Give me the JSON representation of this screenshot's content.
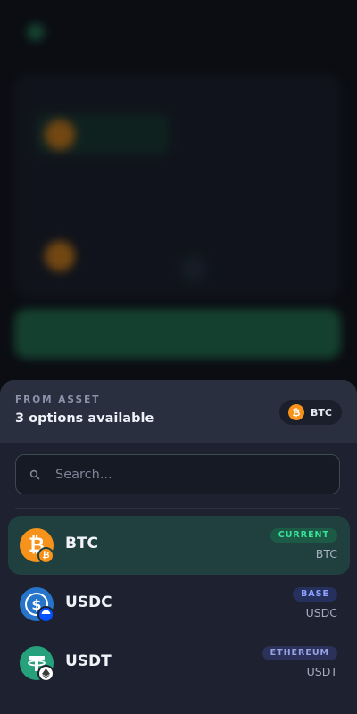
{
  "sheet": {
    "label": "FROM ASSET",
    "options_text": "3 options available",
    "selected_pill": {
      "symbol": "BTC",
      "icon": "bitcoin-icon"
    },
    "search": {
      "placeholder": "Search..."
    },
    "assets": [
      {
        "symbol": "BTC",
        "network_tag": "CURRENT",
        "subtitle": "BTC",
        "coin_icon": "bitcoin-icon",
        "network_icon": "bitcoin-icon",
        "selected": true
      },
      {
        "symbol": "USDC",
        "network_tag": "BASE",
        "subtitle": "USDC",
        "coin_icon": "usdc-icon",
        "network_icon": "base-icon",
        "selected": false
      },
      {
        "symbol": "USDT",
        "network_tag": "ETHEREUM",
        "subtitle": "USDT",
        "coin_icon": "tether-icon",
        "network_icon": "ethereum-icon",
        "selected": false
      }
    ]
  },
  "colors": {
    "bitcoin": "#f7931a",
    "usdc": "#2775ca",
    "tether": "#26a17b",
    "current_tag": "#39e29a"
  }
}
